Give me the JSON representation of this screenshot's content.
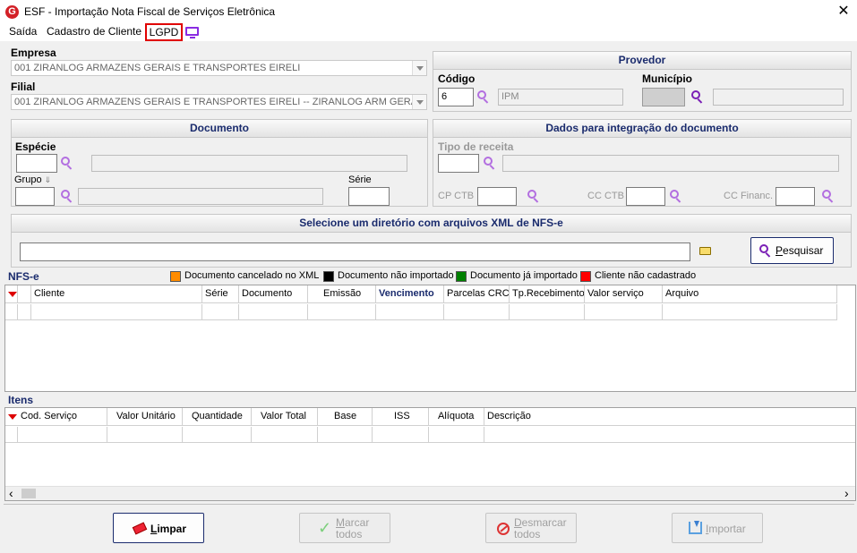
{
  "window": {
    "title": "ESF - Importação Nota Fiscal de Serviços Eletrônica",
    "close": "✕",
    "logo": "G"
  },
  "menu": {
    "saida": "Saída",
    "cadastro": "Cadastro de Cliente",
    "lgpd": "LGPD"
  },
  "empresa": {
    "label": "Empresa",
    "value": "001 ZIRANLOG ARMAZENS GERAIS E TRANSPORTES EIRELI"
  },
  "filial": {
    "label": "Filial",
    "value": "001 ZIRANLOG ARMAZENS GERAIS E TRANSPORTES EIRELI -- ZIRANLOG ARM GERAIS"
  },
  "provedor": {
    "title": "Provedor",
    "codigo_label": "Código",
    "codigo_value": "6",
    "codigo_desc": "IPM",
    "municipio_label": "Município",
    "municipio_value": "",
    "municipio_desc": ""
  },
  "documento": {
    "title": "Documento",
    "especie_label": "Espécie",
    "grupo_label": "Grupo",
    "grupo_icon": "⇓",
    "serie_label": "Série"
  },
  "integracao": {
    "title": "Dados para integração do documento",
    "tipo_receita_label": "Tipo de receita",
    "cp_ctb_label": "CP CTB",
    "cc_ctb_label": "CC CTB",
    "cc_financ_label": "CC Financ."
  },
  "diretorio": {
    "title": "Selecione um diretório com arquivos XML de NFS-e",
    "value": "",
    "search_label": "Pesquisar",
    "search_underline": "P",
    "search_rest": "esquisar"
  },
  "nfse": {
    "label": "NFS-e",
    "legend": [
      {
        "color": "#ff8c00",
        "text": "Documento cancelado no XML"
      },
      {
        "color": "#000000",
        "text": "Documento não importado"
      },
      {
        "color": "#008000",
        "text": "Documento já importado"
      },
      {
        "color": "#ff0000",
        "text": "Cliente não cadastrado"
      }
    ],
    "columns": [
      "Cliente",
      "Série",
      "Documento",
      "Emissão",
      "Vencimento",
      "Parcelas CRC",
      "Tp.Recebimento",
      "Valor serviço",
      "Arquivo"
    ]
  },
  "itens": {
    "label": "Itens",
    "columns": [
      "Cod. Serviço",
      "Valor Unitário",
      "Quantidade",
      "Valor Total",
      "Base",
      "ISS",
      "Alíquota",
      "Descrição"
    ],
    "scroll_left": "‹",
    "scroll_right": "›"
  },
  "buttons": {
    "limpar_u": "L",
    "limpar_rest": "impar",
    "marcar_u": "M",
    "marcar_rest": "arcar",
    "marcar_line2": "todos",
    "desmarcar_u": "D",
    "desmarcar_rest": "esmarcar",
    "desmarcar_line2": "todos",
    "importar_u": "I",
    "importar_rest": "mportar"
  },
  "colors": {
    "accent": "#1a2b6d",
    "lgpd_border": "#e00000",
    "icon_purple": "#b26ee0"
  },
  "icons": [
    "app-logo-icon",
    "close-icon",
    "monitor-icon",
    "search-icon",
    "folder-icon",
    "eraser-icon",
    "check-icon",
    "no-entry-icon",
    "import-icon"
  ]
}
